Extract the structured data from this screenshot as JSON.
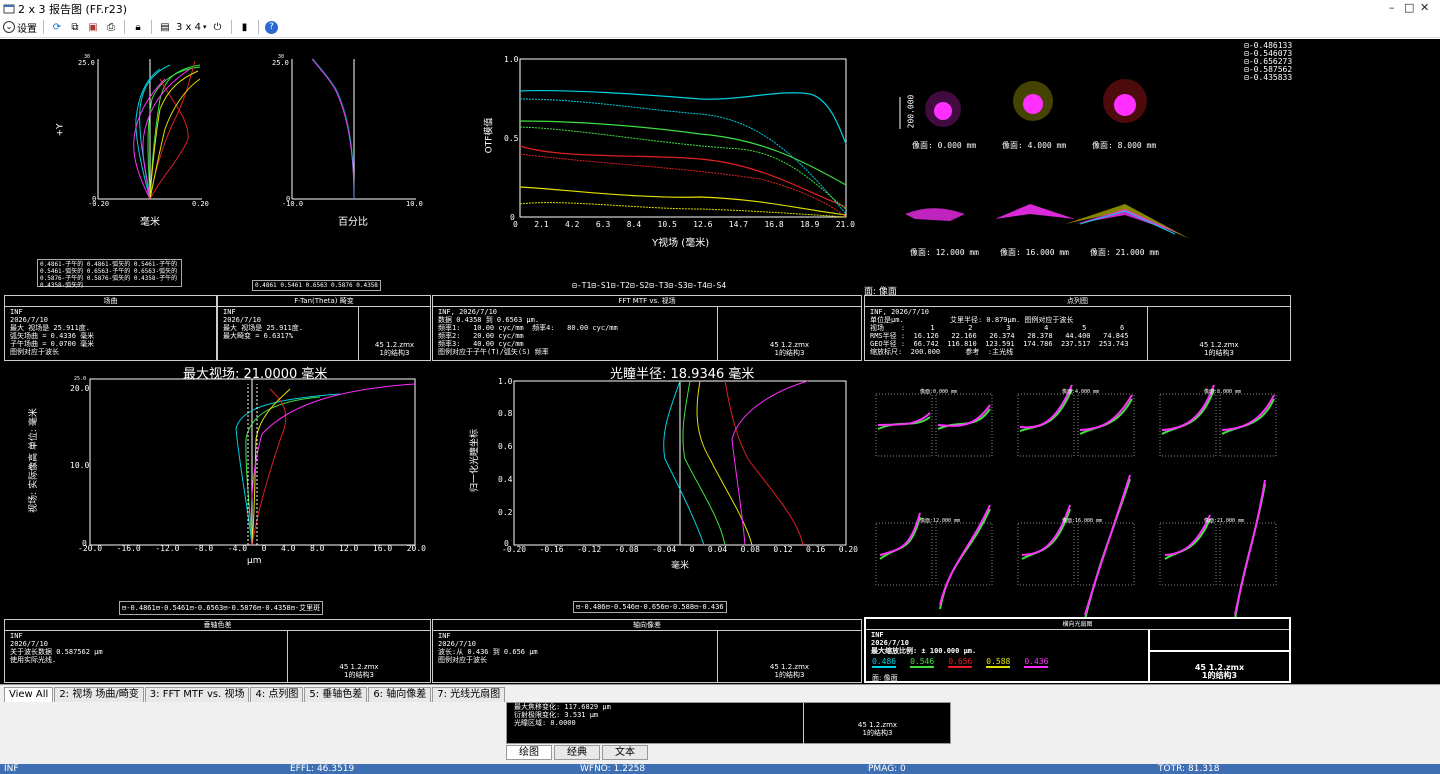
{
  "window": {
    "title": "2 x 3 报告图 (FF.r23)",
    "ctrl_min": "–",
    "ctrl_max": "□",
    "ctrl_close": "✕"
  },
  "toolbar": {
    "settings_label": "设置",
    "layout_label": "3 x 4"
  },
  "field_curvature": {
    "y_axis_label": "+Y",
    "y_top": "25.0",
    "y_top_small": "30",
    "y_bottom": "0",
    "x_left": "-0.20",
    "x_right": "0.20",
    "x_unit": "毫米",
    "legend": [
      "0.4861-子午的",
      "0.4861-弧矢的",
      "0.5461-子午的",
      "0.5461-弧矢的",
      "0.6563-子午的",
      "0.6563-弧矢的",
      "0.5876-子午的",
      "0.5876-弧矢的",
      "0.4358-子午的",
      "0.4358-弧矢的"
    ]
  },
  "distortion": {
    "y_top": "25.0",
    "y_top_small": "30",
    "y_bottom": "0",
    "x_left": "-10.0",
    "x_right": "10.0",
    "x_unit": "百分比",
    "legend": [
      "0.4861",
      "0.5461",
      "0.6563",
      "0.5876",
      "0.4358"
    ]
  },
  "mtf": {
    "y_label": "OTF模值",
    "y_ticks": [
      "1.0",
      "0.5",
      "0"
    ],
    "x_ticks": [
      "0",
      "2.1",
      "4.2",
      "6.3",
      "8.4",
      "10.5",
      "12.6",
      "14.7",
      "16.8",
      "18.9",
      "21.0"
    ],
    "x_label": "Y视场 (毫米)",
    "legend": [
      "T1",
      "S1",
      "T2",
      "S2",
      "T3",
      "S3",
      "T4",
      "S4"
    ]
  },
  "spot": {
    "legend": [
      "0.486133",
      "0.546073",
      "0.656273",
      "0.587562",
      "0.435833"
    ],
    "scale": "200.000",
    "labels": [
      "像面: 0.000 mm",
      "像面: 4.000 mm",
      "像面: 8.000 mm",
      "像面: 12.000 mm",
      "像面: 16.000 mm",
      "像面: 21.000 mm"
    ],
    "surface": "面: 像面"
  },
  "panel_fc": {
    "title": "场曲",
    "text": "INF\n2026/7/10\n最大 视场是 25.911度.\n弧矢场曲 = 0.4336 毫米\n子午场曲 = 0.0700 毫米\n图例对应于波长"
  },
  "panel_dist": {
    "title": "F-Tan(Theta) 畸变",
    "text": "INF\n2026/7/10\n最大 视场是 25.911度.\n最大畸变 = 6.6317%",
    "stamp1": "45 1.2.zmx",
    "stamp2": "1的结构3"
  },
  "panel_mtf": {
    "title": "FFT MTF vs. 视场",
    "text": "INF, 2026/7/10\n数据 0.4358 到 0.6563 μm.\n频率1:   10.00 cyc/mm  频率4:   80.00 cyc/mm\n频率2:   20.00 cyc/mm\n频率3:   40.00 cyc/mm\n图例对应于子午(T)/弧矢(S) 频率",
    "stamp1": "45 1.2.zmx",
    "stamp2": "1的结构3"
  },
  "panel_spot": {
    "title": "点列图",
    "text": "INF, 2026/7/10\n单位是μm.           艾里半径: 0.879μm. 图例对应于波长\n视场    :      1        2        3        4        5        6\nRMS半径 :  16.126   22.166   26.374   28.378   44.400   74.845\nGEO半径 :  66.742  116.810  123.591  174.786  237.517  253.743\n缩放标尺:  200.000      参考  :主光线",
    "stamp1": "45 1.2.zmx",
    "stamp2": "1的结构3"
  },
  "lateral": {
    "title": "最大视场: 21.0000 毫米",
    "y_label": "视场: 实际像高 单位: 毫米",
    "y_ticks": [
      "20.0",
      "10.0",
      "0"
    ],
    "y_top_small": "25.0",
    "x_ticks": [
      "-20.0",
      "-16.0",
      "-12.0",
      "-8.0",
      "-4.0",
      "0",
      "4.0",
      "8.0",
      "12.0",
      "16.0",
      "20.0"
    ],
    "x_unit": "μm",
    "legend": [
      "0.4861",
      "0.5461",
      "0.6563",
      "0.5876",
      "0.4358",
      "艾里斑"
    ]
  },
  "longitudinal": {
    "title": "光瞳半径: 18.9346 毫米",
    "y_label": "归一化光瞳坐标",
    "y_ticks": [
      "1.0",
      "0.8",
      "0.6",
      "0.4",
      "0.2",
      "0"
    ],
    "x_ticks": [
      "-0.20",
      "-0.16",
      "-0.12",
      "-0.08",
      "-0.04",
      "0",
      "0.04",
      "0.08",
      "0.12",
      "0.16",
      "0.20"
    ],
    "x_unit": "毫米",
    "legend": [
      "0.486",
      "0.546",
      "0.656",
      "0.588",
      "0.436"
    ]
  },
  "ray_fan": {
    "labels": [
      "像面:0.000 mm",
      "像面:4.000 mm",
      "像面:8.000 mm",
      "像面:12.000 mm",
      "像面:16.000 mm",
      "像面:21.000 mm"
    ]
  },
  "panel_lat": {
    "title": "垂轴色差",
    "text": "INF\n2026/7/10\n关于波长数据 0.587562 μm\n使用实际光线.",
    "stamp1": "45 1.2.zmx",
    "stamp2": "1的结构3"
  },
  "panel_long": {
    "title": "轴向像差",
    "text": "INF\n2026/7/10\n波长:从 0.436 到 0.656 μm\n图例对应于波长",
    "stamp1": "45 1.2.zmx",
    "stamp2": "1的结构3"
  },
  "panel_fan": {
    "title": "横向光扇图",
    "text": "INF\n2026/7/10\n最大缩放比例: ± 100.000 μm.",
    "wl": [
      "0.486",
      "0.546",
      "0.656",
      "0.588",
      "0.436"
    ],
    "surface": "面: 像面",
    "stamp1": "45 1.2.zmx",
    "stamp2": "1的结构3"
  },
  "tabs": [
    "View All",
    "2: 视场 场曲/畸变",
    "3: FFT MTF vs. 视场",
    "4: 点列图",
    "5: 垂轴色差",
    "6: 轴向像差",
    "7: 光线光扇图"
  ],
  "sub_panel": {
    "text": "最大焦移变化: 117.6829 μm\n衍射极限变化: 3.531 μm\n光瞳区域: 0.0000",
    "stamp1": "45 1.2.zmx",
    "stamp2": "1的结构3"
  },
  "sub_tabs": [
    "绘图",
    "经典",
    "文本"
  ],
  "status": {
    "s1": "INF",
    "s2": "EFFL: 46.3519",
    "s3": "WFNO: 1.2258",
    "s4": "PMAG: 0",
    "s5": "TOTR: 81.318"
  },
  "colors": {
    "blue": "#00d0e0",
    "green": "#40e040",
    "red": "#e02020",
    "yellow": "#e0e000",
    "magenta": "#ff30ff",
    "status": "#3d6fb2"
  }
}
